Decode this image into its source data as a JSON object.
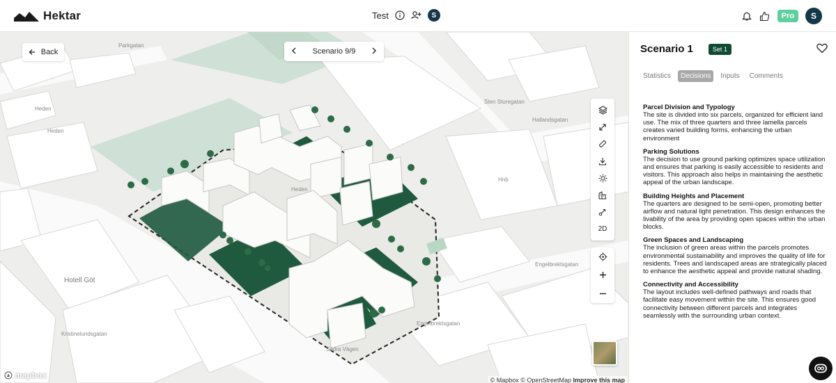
{
  "app": {
    "name": "Hektar"
  },
  "header": {
    "project_title": "Test",
    "user_initial": "S",
    "pro_label": "Pro",
    "account_initial": "S"
  },
  "map": {
    "back_label": "Back",
    "scenario_label": "Scenario 9/9",
    "toolbar": {
      "view_mode_label": "2D"
    },
    "attribution": {
      "mapbox": "© Mapbox",
      "osm": "© OpenStreetMap",
      "improve": "Improve this map"
    },
    "logo_text": "mapbox",
    "street_labels": [
      "Parkgatan",
      "Heden",
      "Heden",
      "Sten Sturegatan",
      "Engelbrektsgatan",
      "Engelbrektsgatan",
      "Hotell Göt",
      "Kristinelundsgatan",
      "Södra Vägen",
      "Hallandsgatan",
      "Hnb",
      "Heden"
    ]
  },
  "panel": {
    "title": "Scenario 1",
    "set_badge": "Set 1",
    "tabs": [
      "Statistics",
      "Decisions",
      "Inputs",
      "Comments"
    ],
    "active_tab": "Decisions",
    "decisions": [
      {
        "heading": "Parcel Division and Typology",
        "body": "The site is divided into six parcels, organized for efficient land use. The mix of three quarters and three lamella parcels creates varied building forms, enhancing the urban environment"
      },
      {
        "heading": "Parking Solutions",
        "body": "The decision to use ground parking optimizes space utilization and ensures that parking is easily accessible to residents and visitors. This approach also helps in maintaining the aesthetic appeal of the urban landscape."
      },
      {
        "heading": "Building Heights and Placement",
        "body": "The quarters are designed to be semi-open, promoting better airflow and natural light penetration. This design enhances the livability of the area by providing open spaces within the urban blocks."
      },
      {
        "heading": "Green Spaces and Landscaping",
        "body": "The inclusion of green areas within the parcels promotes environmental sustainability and improves the quality of life for residents. Trees and landscaped areas are strategically placed to enhance the aesthetic appeal and provide natural shading."
      },
      {
        "heading": "Connectivity and Accessibility",
        "body": "The layout includes well-defined pathways and roads that facilitate easy movement within the site. This ensures good connectivity between different parcels and integrates seamlessly with the surrounding urban context."
      }
    ]
  },
  "colors": {
    "brand_dark": "#14384a",
    "set_badge": "#0f4a33",
    "pro_badge": "#5fcf9e",
    "park_green": "#cfe1d6",
    "courtyard_green": "#1f5a3f"
  }
}
